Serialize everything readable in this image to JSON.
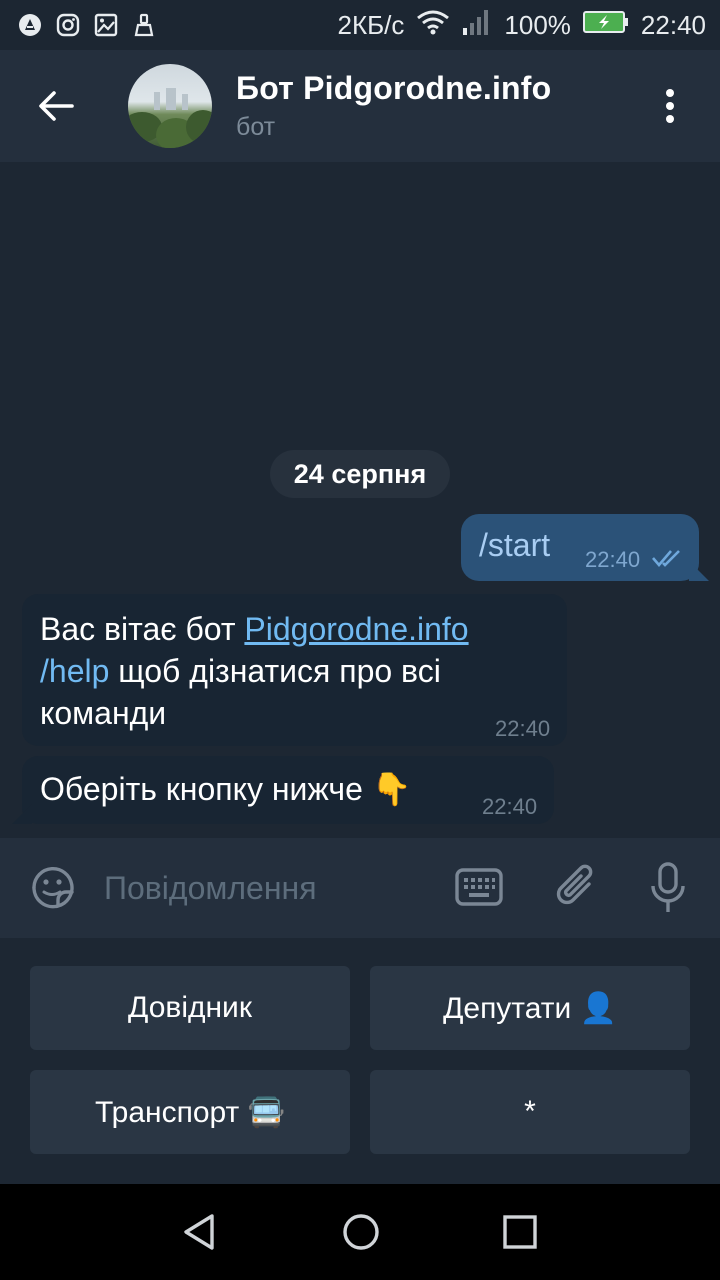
{
  "status_bar": {
    "data_speed": "2КБ/с",
    "battery": "100%",
    "time": "22:40"
  },
  "header": {
    "title": "Бот Pidgorodne.info",
    "subtitle": "бот"
  },
  "messages": {
    "date_separator": "24 серпня",
    "outgoing": {
      "text": "/start",
      "time": "22:40",
      "status": "read"
    },
    "incoming_1": {
      "prefix": "Вас вітає  бот ",
      "link": "Pidgorodne.info",
      "command": "/help",
      "rest_line2": " щоб дізнатися про всі",
      "line3": "команди",
      "time": "22:40"
    },
    "incoming_2": {
      "text": "Оберіть кнопку нижче 👇",
      "time": "22:40"
    }
  },
  "composer": {
    "placeholder": "Повідомлення"
  },
  "reply_keyboard": {
    "buttons": [
      {
        "label": "Довідник"
      },
      {
        "label": "Депутати 👤"
      },
      {
        "label": "Транспорт 🚍"
      },
      {
        "label": "*"
      }
    ]
  },
  "colors": {
    "chat_bg": "#1d2733",
    "header_bg": "#242f3d",
    "outgoing_bubble": "#2b5278",
    "incoming_bubble": "#182533",
    "link": "#71baf2"
  }
}
